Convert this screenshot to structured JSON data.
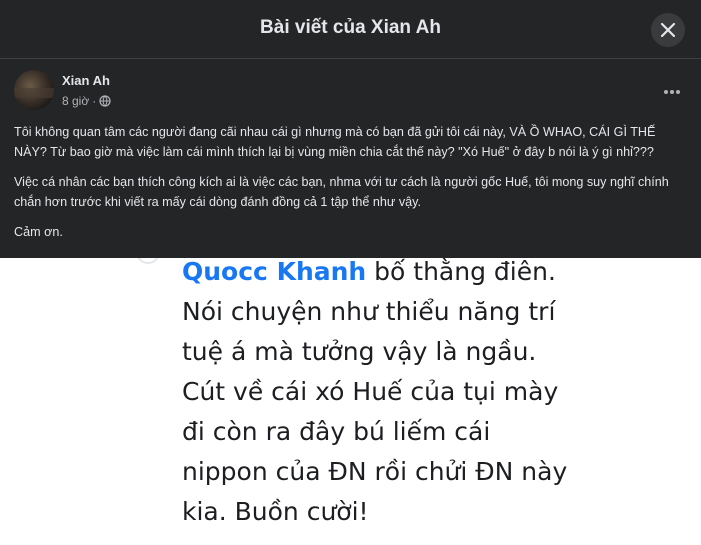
{
  "modal": {
    "title": "Bài viết của Xian Ah"
  },
  "post": {
    "author": "Xian Ah",
    "time": "8 giờ",
    "separator": "·",
    "privacy_icon": "globe-icon",
    "paragraphs": [
      "Tôi không quan tâm các người đang cãi nhau cái gì nhưng mà có bạn đã gửi tôi cái này, VÀ Ồ WHAO, CÁI GÌ THẾ NÀY? Từ bao giờ mà việc làm cái mình thích lại bị vùng miền chia cắt thế này? \"Xó Huế\" ở đây b nói là ý gì nhỉ???",
      "Việc cá nhân các bạn thích công kích ai là việc các bạn, nhma với tư cách là người gốc Huế, tôi mong suy nghĩ chính chắn hơn trước khi viết ra mấy cái dòng đánh đồng cả 1 tập thể như vậy.",
      "Cảm ơn."
    ]
  },
  "image": {
    "name": "Quocc Khanh",
    "first_line_rest": " bố thằng điên.",
    "lines": [
      "Nói chuyện như thiểu năng trí",
      "tuệ á mà tưởng vậy là ngầu.",
      "Cút về cái xó Huế của tụi mày",
      "đi còn ra đây bú liếm cái",
      "nippon của ĐN rồi chửi ĐN này",
      "kia. Buồn cười!"
    ]
  },
  "colors": {
    "background": "#242526",
    "link_blue": "#1877f2"
  }
}
